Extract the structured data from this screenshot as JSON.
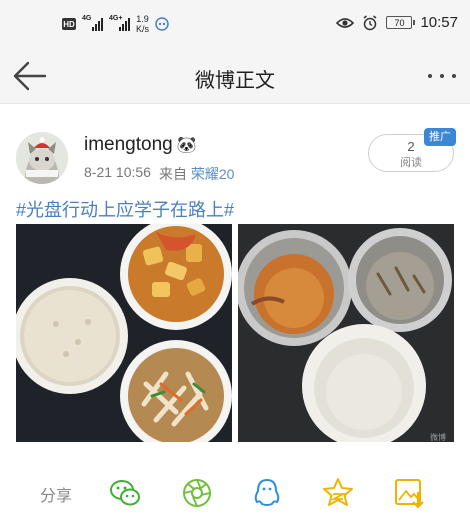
{
  "status_bar": {
    "hd": "HD",
    "sim1": "4G",
    "sim2": "4G+",
    "speed_value": "1.9",
    "speed_unit": "K/s",
    "battery": "70",
    "time": "10:57"
  },
  "header": {
    "title": "微博正文"
  },
  "post": {
    "username": "imengtong",
    "username_emoji": "🐼",
    "date_time": "8-21 10:56",
    "from_label": "来自",
    "device": "荣耀20",
    "read_count": "2",
    "read_label": "阅读",
    "promo_badge": "推广",
    "hashtag": "#光盘行动上应学子在路上#",
    "watermark": "微博"
  },
  "share_bar": {
    "label": "分享",
    "icons": [
      "wechat-icon",
      "moments-icon",
      "qq-icon",
      "qzone-star-icon",
      "save-image-icon"
    ]
  },
  "colors": {
    "link": "#4a7fc0",
    "wechat": "#3eb135",
    "moments": "#6fbf3b",
    "qq": "#2a8fe0",
    "qzone": "#f0b400",
    "save": "#f0b400"
  }
}
